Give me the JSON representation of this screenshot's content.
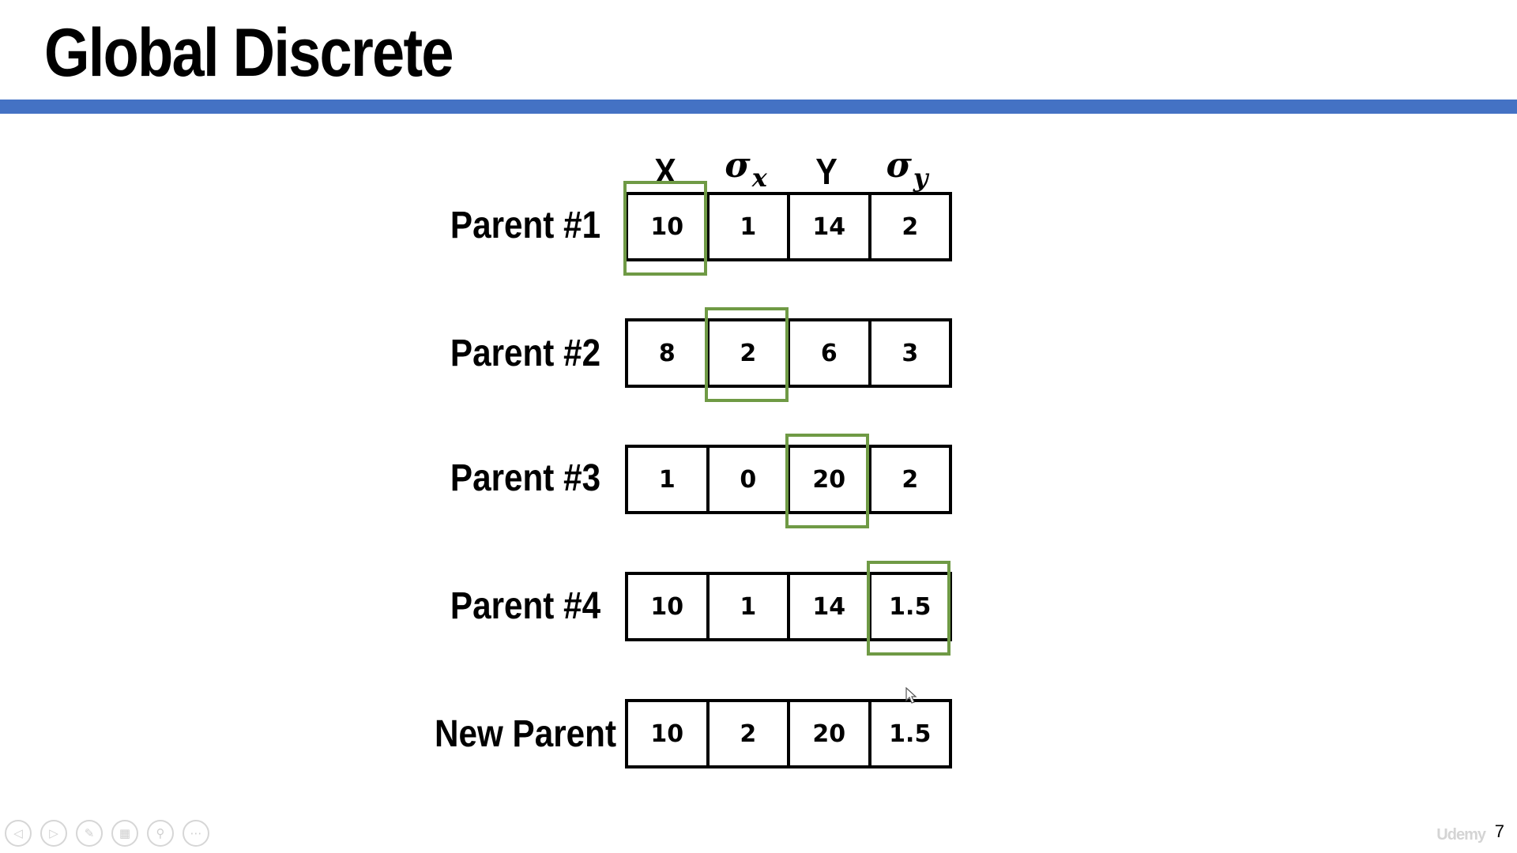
{
  "slide": {
    "title": "Global Discrete",
    "page_number": "7",
    "watermark": "Udemy"
  },
  "columns": [
    {
      "label": "X"
    },
    {
      "symbol": "σ",
      "sub": "x"
    },
    {
      "label": "Y"
    },
    {
      "symbol": "σ",
      "sub": "y"
    }
  ],
  "rows": [
    {
      "label": "Parent #1",
      "values": [
        "10",
        "1",
        "14",
        "2"
      ],
      "selected_index": 0
    },
    {
      "label": "Parent #2",
      "values": [
        "8",
        "2",
        "6",
        "3"
      ],
      "selected_index": 1
    },
    {
      "label": "Parent #3",
      "values": [
        "1",
        "0",
        "20",
        "2"
      ],
      "selected_index": 2
    },
    {
      "label": "Parent #4",
      "values": [
        "10",
        "1",
        "14",
        "1.5"
      ],
      "selected_index": 3
    },
    {
      "label": "New Parent",
      "values": [
        "10",
        "2",
        "20",
        "1.5"
      ],
      "selected_index": null
    }
  ],
  "colors": {
    "title_rule": "#4472c4",
    "selection": "#6f9a45"
  },
  "toolbar": {
    "buttons": [
      {
        "name": "previous-slide",
        "icon": "arrow-left-icon",
        "glyph": "◁"
      },
      {
        "name": "next-slide",
        "icon": "arrow-right-icon",
        "glyph": "▷"
      },
      {
        "name": "pen-tool",
        "icon": "pen-icon",
        "glyph": "✎"
      },
      {
        "name": "see-all-slides",
        "icon": "grid-icon",
        "glyph": "▦"
      },
      {
        "name": "zoom",
        "icon": "magnifier-icon",
        "glyph": "⚲"
      },
      {
        "name": "more-options",
        "icon": "more-icon",
        "glyph": "⋯"
      }
    ]
  }
}
